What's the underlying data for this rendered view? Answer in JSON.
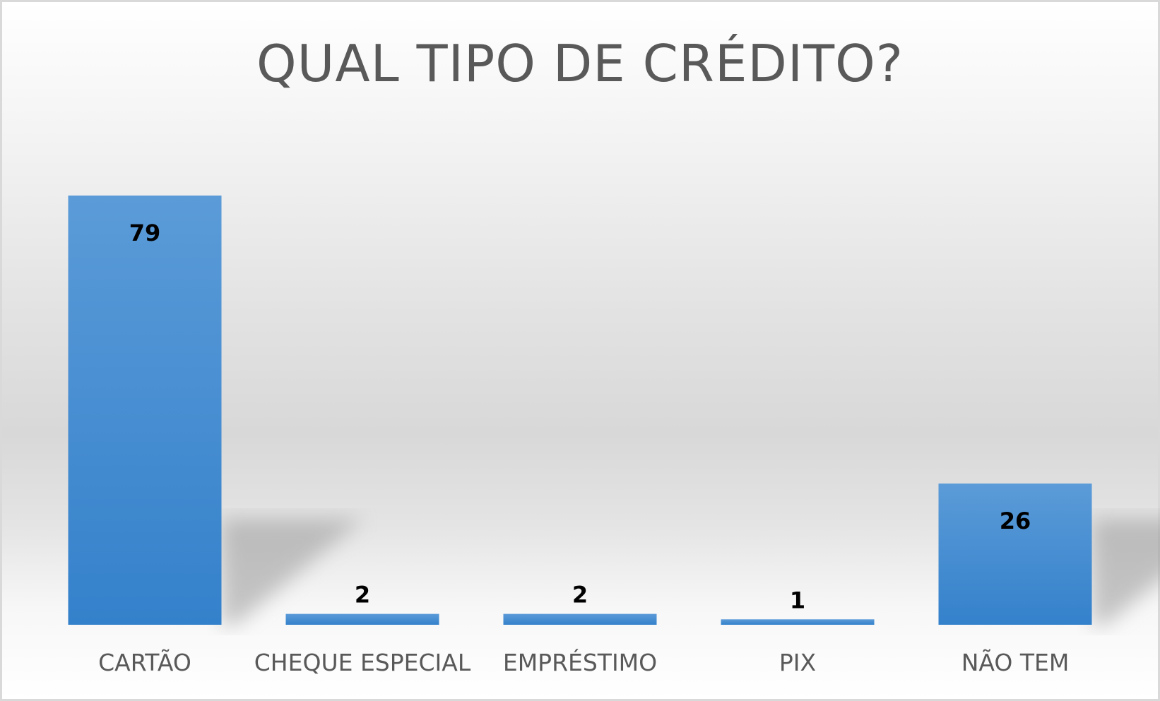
{
  "chart_data": {
    "type": "bar",
    "title": "QUAL TIPO DE CRÉDITO?",
    "categories": [
      "CARTÃO",
      "CHEQUE ESPECIAL",
      "EMPRÉSTIMO",
      "PIX",
      "NÃO TEM"
    ],
    "values": [
      79,
      2,
      2,
      1,
      26
    ],
    "xlabel": "",
    "ylabel": "",
    "ylim": [
      0,
      79
    ],
    "grid": false,
    "legend": "none",
    "bar_color": "#3a86cc"
  }
}
